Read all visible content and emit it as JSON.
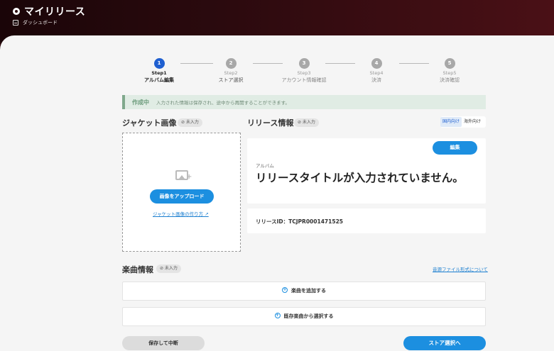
{
  "header": {
    "title": "マイリリース",
    "breadcrumb": "ダッシュボード"
  },
  "stepper": [
    {
      "dot": "1",
      "num": "Step1",
      "label": "アルバム編集",
      "active": true
    },
    {
      "dot": "2",
      "num": "Step2",
      "label": "ストア選択",
      "active": false
    },
    {
      "dot": "3",
      "num": "Step3",
      "label": "アカウント情報確認",
      "active": false
    },
    {
      "dot": "4",
      "num": "Step4",
      "label": "決済",
      "active": false
    },
    {
      "dot": "5",
      "num": "Step5",
      "label": "決済確認",
      "active": false
    }
  ],
  "status": {
    "tag": "作成中",
    "text": "入力された情報は保存され、途中から再開することができます。"
  },
  "jacket": {
    "title": "ジャケット画像",
    "badge": "⊘ 未入力",
    "upload_label": "画像をアップロード",
    "howto_label": "ジャケット画像の作り方 ↗"
  },
  "release": {
    "title": "リリース情報",
    "badge": "⊘ 未入力",
    "toggle": {
      "domestic": "国内向け",
      "overseas": "海外向け",
      "selected": "domestic"
    },
    "edit_label": "編集",
    "album_label": "アルバム",
    "album_title": "リリースタイトルが入力されていません。",
    "release_id": "リリースID：TCJPR0001471525"
  },
  "tracks": {
    "title": "楽曲情報",
    "badge": "⊘ 未入力",
    "audio_link": "音源ファイル形式について",
    "add_label": "楽曲を追加する",
    "select_label": "既存楽曲から選択する"
  },
  "footer": {
    "save_label": "保存して中断",
    "next_label": "ストア選択へ"
  },
  "colors": {
    "accent": "#1c8fe0",
    "active_step": "#1f5fd0",
    "header_bg": "#2a0a0d",
    "status_bg": "#e0ece4"
  }
}
